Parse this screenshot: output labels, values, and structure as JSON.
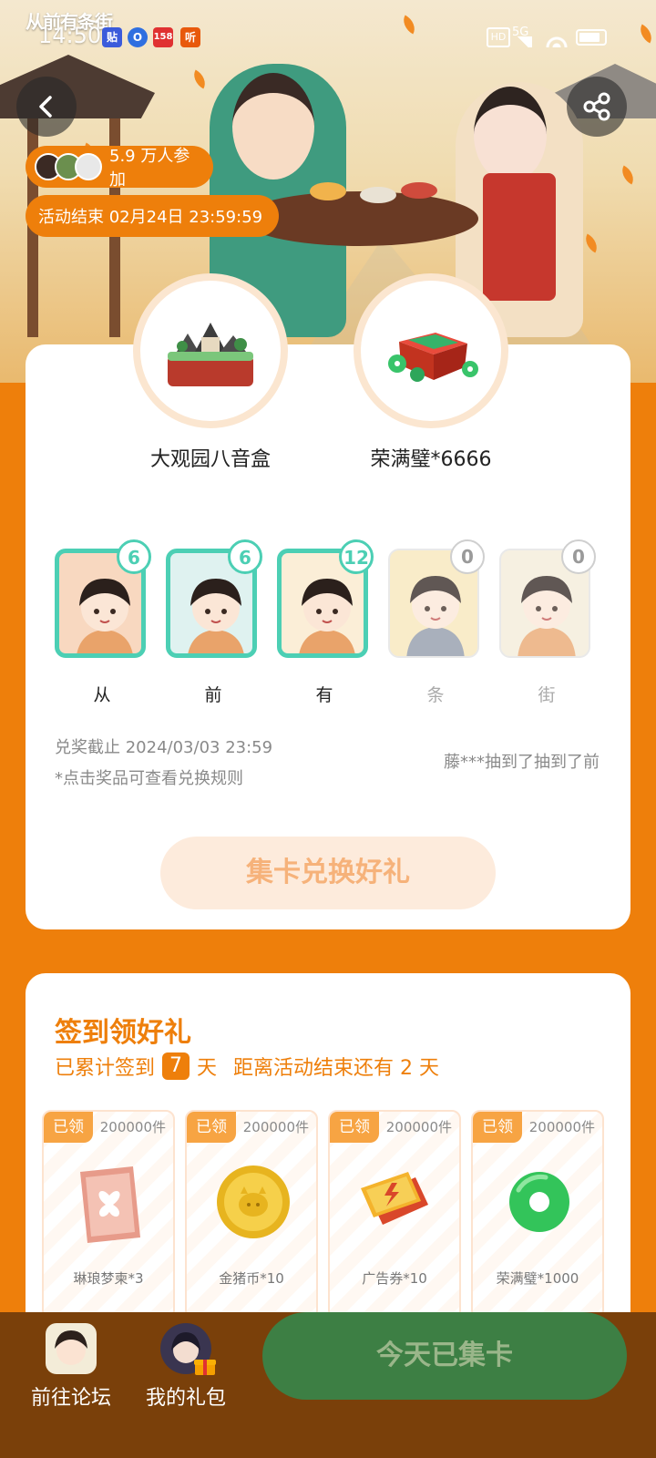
{
  "status_bar": {
    "time": "14:50",
    "app_logo_text": "从前有条街",
    "app_icons": [
      "贴",
      "O",
      "158",
      "听"
    ],
    "network": "5G"
  },
  "hero": {
    "participants": "5.9 万人参加",
    "activity_end": "活动结束 02月24日 23:59:59"
  },
  "prizes": [
    {
      "name": "大观园八音盒"
    },
    {
      "name": "荣满璧*6666"
    }
  ],
  "cards": [
    {
      "label": "从",
      "count": "6",
      "collected": true,
      "bg": "#f8d8c0"
    },
    {
      "label": "前",
      "count": "6",
      "collected": true,
      "bg": "#dff2f0"
    },
    {
      "label": "有",
      "count": "12",
      "collected": true,
      "bg": "#fbeed7"
    },
    {
      "label": "条",
      "count": "0",
      "collected": false,
      "bg": "#f7e6b7"
    },
    {
      "label": "街",
      "count": "0",
      "collected": false,
      "bg": "#f3ecd8"
    }
  ],
  "redeem_info": {
    "deadline": "兑奖截止 2024/03/03 23:59",
    "hint": "*点击奖品可查看兑换规则",
    "ticker": "藤***抽到了抽到了前",
    "button": "集卡兑换好礼"
  },
  "signin": {
    "title": "签到领好礼",
    "prefix": "已累计签到",
    "days": "7",
    "day_unit": "天",
    "remain": "距离活动结束还有 2 天",
    "rewards": [
      {
        "claimed": "已领",
        "stock": "200000件",
        "name": "琳琅梦柬*3"
      },
      {
        "claimed": "已领",
        "stock": "200000件",
        "name": "金猪币*10"
      },
      {
        "claimed": "已领",
        "stock": "200000件",
        "name": "广告券*10"
      },
      {
        "claimed": "已领",
        "stock": "200000件",
        "name": "荣满璧*1000"
      }
    ]
  },
  "bottom_bar": {
    "forum": "前往论坛",
    "gifts": "我的礼包",
    "collect_button": "今天已集卡"
  },
  "colors": {
    "accent": "#ee7f0b",
    "bottom_bar": "#7a400a",
    "collect_button": "#3d7f44",
    "card_border": "#4ccfb4"
  }
}
